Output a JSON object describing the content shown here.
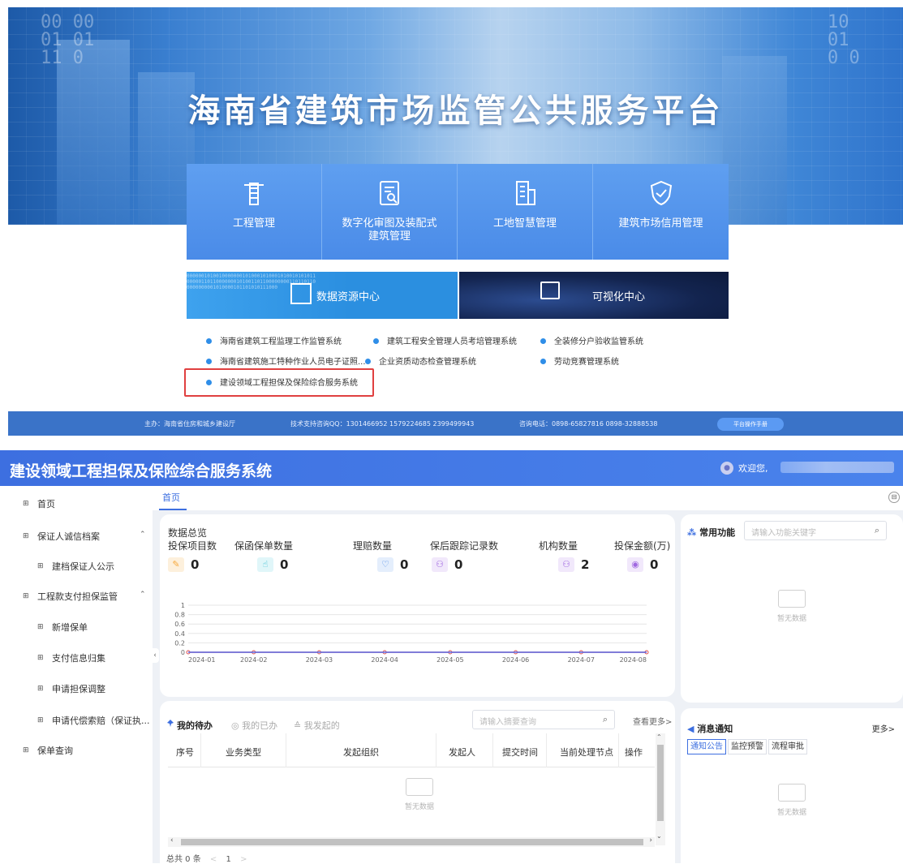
{
  "portal": {
    "title": "海南省建筑市场监管公共服务平台",
    "tiles": [
      {
        "label": "工程管理",
        "icon": "crane-icon"
      },
      {
        "label": "数字化审图及装配式\n建筑管理",
        "icon": "document-review-icon"
      },
      {
        "label": "工地智慧管理",
        "icon": "building-icon"
      },
      {
        "label": "建筑市场信用管理",
        "icon": "shield-icon"
      }
    ],
    "data_center": "数据资源中心",
    "visual_center": "可视化中心",
    "systems": [
      "海南省建筑工程监理工作监管系统",
      "建筑工程安全管理人员考培管理系统",
      "全装修分户验收监管系统",
      "海南省建筑施工特种作业人员电子证照...",
      "企业资质动态检查管理系统",
      "劳动竞赛管理系统",
      "建设领域工程担保及保险综合服务系统"
    ],
    "footer": {
      "host": "主办：海南省住房和城乡建设厅",
      "support": "技术支持咨询QQ：1301466952 1579224685 2399499943",
      "phone": "咨询电话：0898-65827816  0898-32888538",
      "manual": "平台操作手册"
    }
  },
  "app": {
    "title": "建设领域工程担保及保险综合服务系统",
    "welcome": "欢迎您,",
    "menu": [
      {
        "label": "首页",
        "expandable": false,
        "child": false
      },
      {
        "label": "保证人诚信档案",
        "expandable": true,
        "child": false
      },
      {
        "label": "建档保证人公示",
        "expandable": false,
        "child": true
      },
      {
        "label": "工程款支付担保监管",
        "expandable": true,
        "child": false
      },
      {
        "label": "新增保单",
        "expandable": false,
        "child": true
      },
      {
        "label": "支付信息归集",
        "expandable": false,
        "child": true
      },
      {
        "label": "申请担保调整",
        "expandable": false,
        "child": true
      },
      {
        "label": "申请代偿索赔（保证执...",
        "expandable": false,
        "child": true
      },
      {
        "label": "保单查询",
        "expandable": false,
        "child": false
      }
    ],
    "tab_home": "首页",
    "overview": {
      "title": "数据总览",
      "stats": [
        {
          "name": "投保项目数",
          "value": "0",
          "color": "#f7a83b",
          "bg": "#fdf0dc",
          "icon": "pencil-icon"
        },
        {
          "name": "保函保单数量",
          "value": "0",
          "color": "#3bc0d4",
          "bg": "#e0f6f9",
          "icon": "thumb-up-icon"
        },
        {
          "name": "理赔数量",
          "value": "0",
          "color": "#4d8be8",
          "bg": "#e4eefc",
          "icon": "heart-icon"
        },
        {
          "name": "保后跟踪记录数",
          "value": "0",
          "color": "#a068e0",
          "bg": "#f1e8fb",
          "icon": "person-icon"
        },
        {
          "name": "机构数量",
          "value": "2",
          "color": "#a068e0",
          "bg": "#f1e8fb",
          "icon": "org-icon"
        },
        {
          "name": "投保金额(万)",
          "value": "0",
          "color": "#a068e0",
          "bg": "#f1e8fb",
          "icon": "coin-icon"
        }
      ]
    },
    "todo": {
      "tabs": [
        "我的待办",
        "我的已办",
        "我发起的"
      ],
      "search_placeholder": "请输入摘要查询",
      "more": "查看更多>",
      "columns": [
        "序号",
        "业务类型",
        "发起组织",
        "发起人",
        "提交时间",
        "当前处理节点",
        "操作"
      ],
      "empty": "暂无数据",
      "total": "总共 0 条",
      "page": "1"
    },
    "common": {
      "title": "常用功能",
      "search_placeholder": "请输入功能关键字",
      "empty": "暂无数据"
    },
    "notice": {
      "title": "消息通知",
      "more": "更多>",
      "tabs": [
        "通知公告",
        "监控预警",
        "流程审批"
      ],
      "empty": "暂无数据"
    }
  },
  "chart_data": {
    "type": "line",
    "categories": [
      "2024-01",
      "2024-02",
      "2024-03",
      "2024-04",
      "2024-05",
      "2024-06",
      "2024-07",
      "2024-08"
    ],
    "series": [
      {
        "values": [
          0,
          0,
          0,
          0,
          0,
          0,
          0,
          0
        ],
        "color": "#e05252"
      },
      {
        "values": [
          0,
          0,
          0,
          0,
          0,
          0,
          0,
          0
        ],
        "color": "#5b6ee8"
      }
    ],
    "yticks": [
      "0",
      "0.2",
      "0.4",
      "0.6",
      "0.8",
      "1"
    ],
    "ylim": [
      0,
      1
    ],
    "grid": true
  }
}
